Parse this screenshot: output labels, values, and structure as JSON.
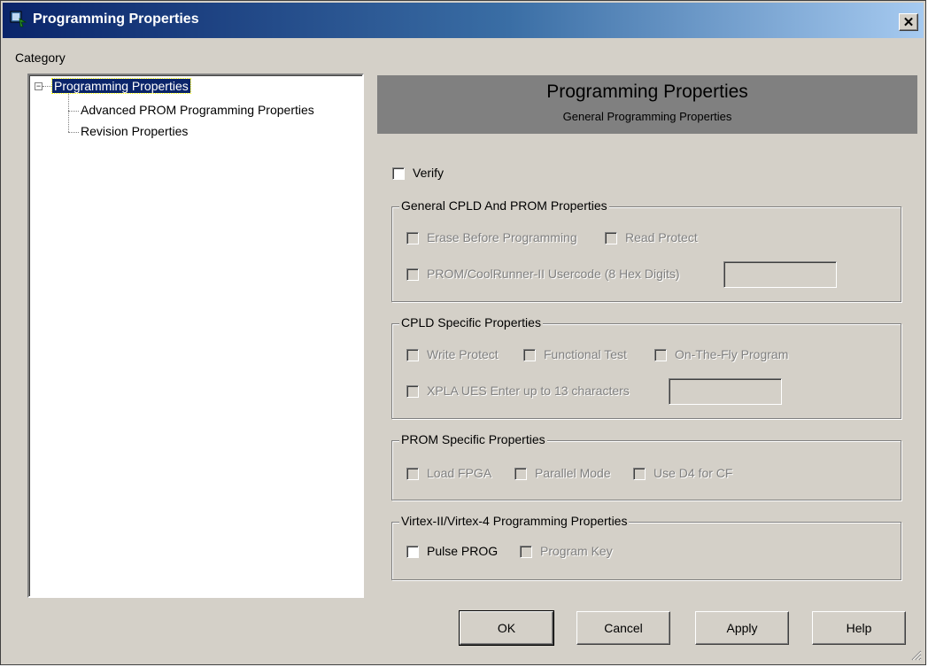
{
  "window": {
    "title": "Programming Properties",
    "close_glyph": "✕"
  },
  "category_label": "Category",
  "tree": {
    "items": [
      {
        "label": "Programming Properties",
        "selected": true,
        "expander": "−"
      },
      {
        "label": "Advanced PROM Programming Properties"
      },
      {
        "label": "Revision Properties"
      }
    ]
  },
  "header": {
    "title": "Programming Properties",
    "subtitle": "General Programming Properties"
  },
  "verify_label": "Verify",
  "groups": {
    "general": {
      "title": "General CPLD And PROM Properties",
      "erase_label": "Erase Before Programming",
      "read_protect_label": "Read Protect",
      "usercode_label": "PROM/CoolRunner-II Usercode (8 Hex Digits)",
      "usercode_value": ""
    },
    "cpld": {
      "title": "CPLD Specific Properties",
      "write_protect_label": "Write Protect",
      "functional_test_label": "Functional Test",
      "on_the_fly_label": "On-The-Fly Program",
      "xpla_label": "XPLA UES Enter up to 13 characters",
      "xpla_value": ""
    },
    "prom": {
      "title": "PROM Specific Properties",
      "load_fpga_label": "Load FPGA",
      "parallel_mode_label": "Parallel Mode",
      "use_d4_label": "Use D4 for CF"
    },
    "virtex": {
      "title": "Virtex-II/Virtex-4 Programming Properties",
      "pulse_prog_label": "Pulse PROG",
      "program_key_label": "Program Key"
    }
  },
  "buttons": {
    "ok": "OK",
    "cancel": "Cancel",
    "apply": "Apply",
    "help": "Help"
  },
  "colors": {
    "titlebar_start": "#0a246a",
    "titlebar_end": "#a6caf0",
    "face": "#d4d0c8",
    "header_panel": "#808080",
    "selection": "#0a246a"
  }
}
